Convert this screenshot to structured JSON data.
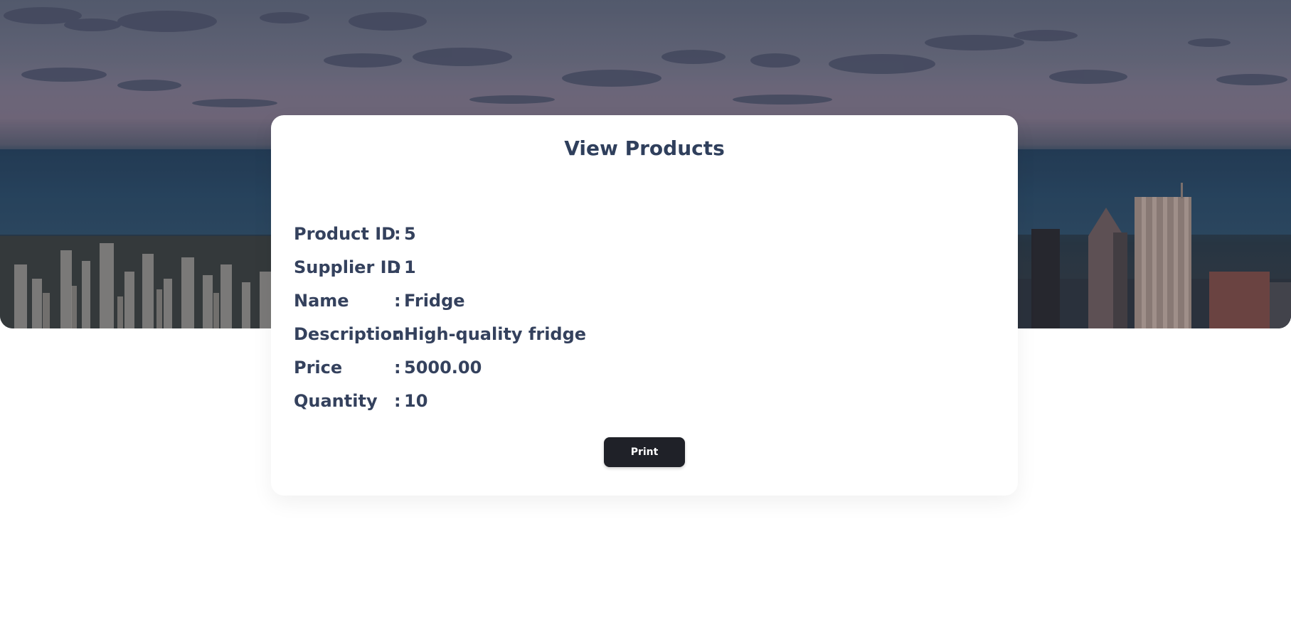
{
  "page": {
    "title": "View Products"
  },
  "product": {
    "fields": [
      {
        "label": "Product ID",
        "value": "5"
      },
      {
        "label": "Supplier ID",
        "value": "1"
      },
      {
        "label": "Name",
        "value": "Fridge"
      },
      {
        "label": "Description",
        "value": "High-quality fridge"
      },
      {
        "label": "Price",
        "value": "5000.00"
      },
      {
        "label": "Quantity",
        "value": "10"
      }
    ],
    "separator": ":"
  },
  "actions": {
    "print_label": "Print"
  },
  "colors": {
    "title_text": "#2f3f5c",
    "field_text": "#34415d",
    "button_bg": "#1f2128",
    "button_text": "#ffffff"
  }
}
